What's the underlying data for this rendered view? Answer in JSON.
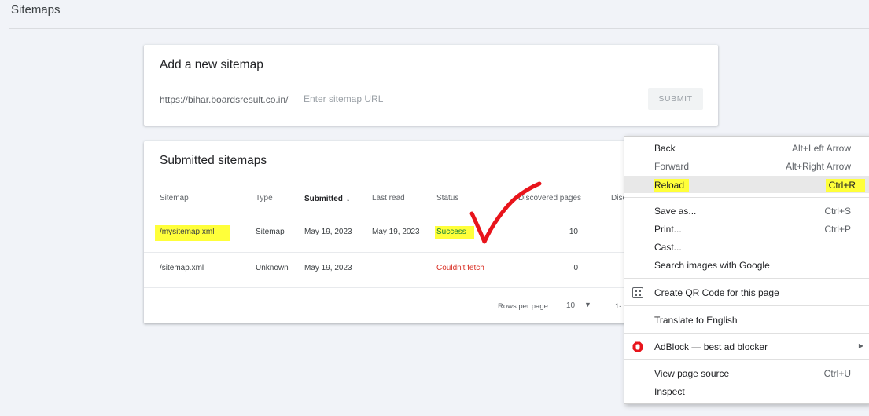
{
  "page": {
    "title": "Sitemaps"
  },
  "add_sitemap": {
    "title": "Add a new sitemap",
    "url_prefix": "https://bihar.boardsresult.co.in/",
    "placeholder": "Enter sitemap URL",
    "value": "",
    "submit_label": "SUBMIT"
  },
  "submitted": {
    "title": "Submitted sitemaps",
    "columns": {
      "sitemap": "Sitemap",
      "type": "Type",
      "submitted": "Submitted",
      "last_read": "Last read",
      "status": "Status",
      "discovered": "Discovered pages",
      "disc_videos": "Disc"
    },
    "rows": [
      {
        "sitemap": "/mysitemap.xml",
        "type": "Sitemap",
        "submitted": "May 19, 2023",
        "last_read": "May 19, 2023",
        "status": "Success",
        "discovered": "10"
      },
      {
        "sitemap": "/sitemap.xml",
        "type": "Unknown",
        "submitted": "May 19, 2023",
        "last_read": "",
        "status": "Couldn't fetch",
        "discovered": "0"
      }
    ],
    "footer": {
      "rows_per_page_label": "Rows per page:",
      "rows_per_page_value": "10",
      "range": "1-"
    }
  },
  "context_menu": {
    "items": {
      "back": {
        "label": "Back",
        "shortcut": "Alt+Left Arrow"
      },
      "forward": {
        "label": "Forward",
        "shortcut": "Alt+Right Arrow"
      },
      "reload": {
        "label": "Reload",
        "shortcut": "Ctrl+R"
      },
      "save_as": {
        "label": "Save as...",
        "shortcut": "Ctrl+S"
      },
      "print": {
        "label": "Print...",
        "shortcut": "Ctrl+P"
      },
      "cast": {
        "label": "Cast..."
      },
      "search_images": {
        "label": "Search images with Google"
      },
      "qr_code": {
        "label": "Create QR Code for this page"
      },
      "translate": {
        "label": "Translate to English"
      },
      "adblock": {
        "label": "AdBlock — best ad blocker"
      },
      "view_source": {
        "label": "View page source",
        "shortcut": "Ctrl+U"
      },
      "inspect": {
        "label": "Inspect"
      }
    }
  },
  "colors": {
    "highlight": "#ffff3a",
    "success": "#188038",
    "error": "#d93025",
    "annotation": "#e8141b"
  }
}
